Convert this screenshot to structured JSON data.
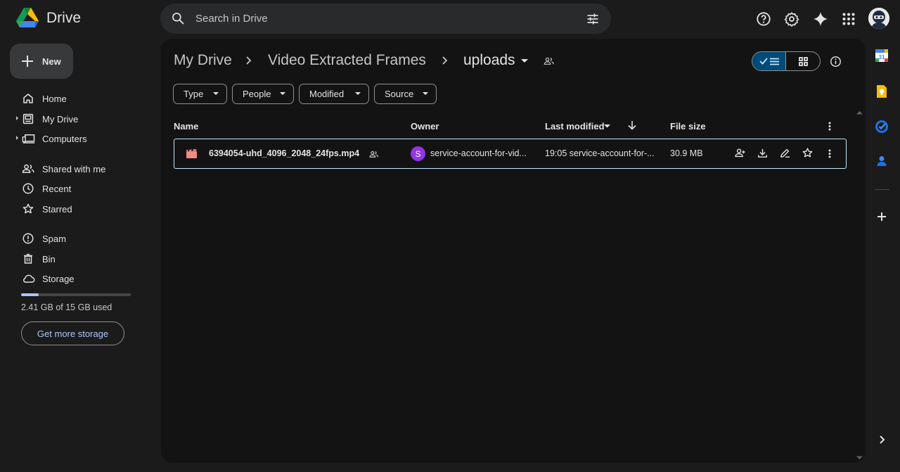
{
  "app": {
    "name": "Drive"
  },
  "search": {
    "placeholder": "Search in Drive"
  },
  "sidebar": {
    "new_label": "New",
    "items": [
      {
        "label": "Home",
        "icon": "home-icon"
      },
      {
        "label": "My Drive",
        "icon": "my-drive-icon"
      },
      {
        "label": "Computers",
        "icon": "computers-icon"
      },
      {
        "label": "Shared with me",
        "icon": "shared-icon"
      },
      {
        "label": "Recent",
        "icon": "clock-icon"
      },
      {
        "label": "Starred",
        "icon": "star-icon"
      },
      {
        "label": "Spam",
        "icon": "spam-icon"
      },
      {
        "label": "Bin",
        "icon": "bin-icon"
      },
      {
        "label": "Storage",
        "icon": "cloud-icon"
      }
    ],
    "storage": {
      "used_text": "2.41 GB of 15 GB used",
      "fraction_used": 0.16
    },
    "get_storage_label": "Get more storage"
  },
  "breadcrumb": {
    "items": [
      "My Drive",
      "Video Extracted Frames",
      "uploads"
    ]
  },
  "filters": [
    "Type",
    "People",
    "Modified",
    "Source"
  ],
  "table": {
    "columns": {
      "name": "Name",
      "owner": "Owner",
      "modified": "Last modified",
      "size": "File size"
    },
    "rows": [
      {
        "name": "6394054-uhd_4096_2048_24fps.mp4",
        "owner_initial": "S",
        "owner": "service-account-for-vid...",
        "modified": "19:05 service-account-for-...",
        "size": "30.9 MB"
      }
    ]
  },
  "colors": {
    "background": "#1b1b1b",
    "panel": "#131314",
    "accent": "#a8c7fa",
    "selected_toggle": "#004a77",
    "owner_avatar": "#9334e6",
    "video_icon": "#f28b82"
  }
}
